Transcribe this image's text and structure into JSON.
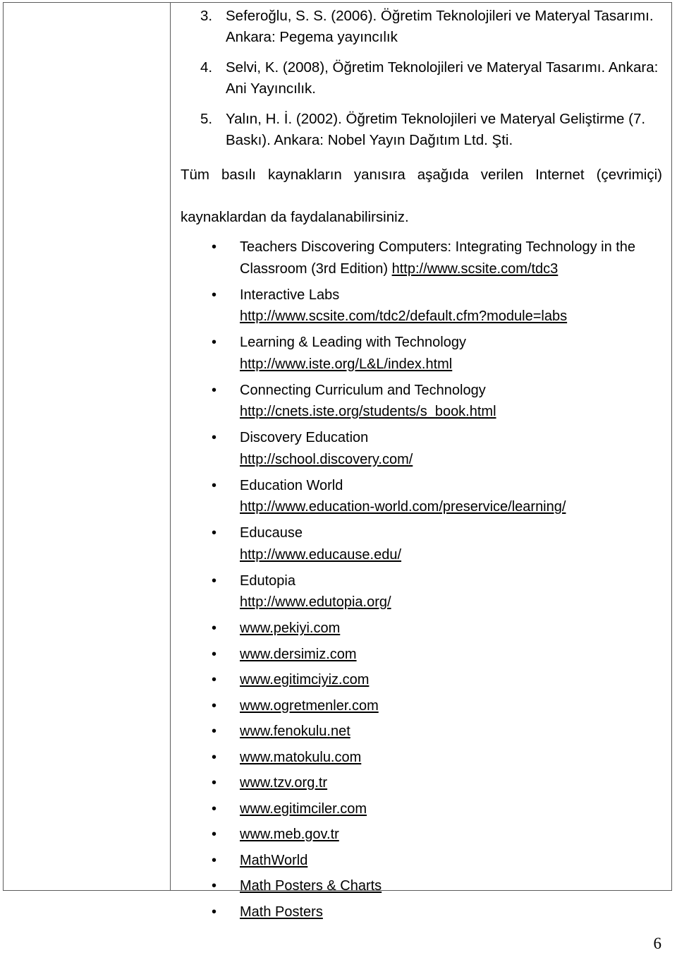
{
  "document": {
    "page_number": "6"
  },
  "references": {
    "items": [
      {
        "number": "3.",
        "text": "Seferoğlu, S. S. (2006). Öğretim Teknolojileri ve Materyal Tasarımı. Ankara: Pegema yayıncılık"
      },
      {
        "number": "4.",
        "text": "Selvi, K. (2008), Öğretim Teknolojileri ve Materyal Tasarımı. Ankara: Ani Yayıncılık."
      },
      {
        "number": "5.",
        "text": "Yalın, H. İ. (2002). Öğretim Teknolojileri ve Materyal Geliştirme (7. Baskı). Ankara: Nobel Yayın Dağıtım Ltd. Şti."
      }
    ]
  },
  "intro": {
    "line1": "Tüm basılı kaynakların yanısıra aşağıda verilen Internet (çevrimiçi)",
    "line2": "kaynaklardan da faydalanabilirsiniz."
  },
  "resources": {
    "bullet_glyph": "•",
    "items": [
      {
        "title": "Teachers Discovering Computers: Integrating Technology in the Classroom (3rd Edition)",
        "url": "http://www.scsite.com/tdc3",
        "layout": "inline"
      },
      {
        "title": "Interactive Labs",
        "url": "http://www.scsite.com/tdc2/default.cfm?module=labs",
        "layout": "two-line"
      },
      {
        "title": "Learning & Leading with Technology",
        "url": "http://www.iste.org/L&L/index.html",
        "layout": "two-line"
      },
      {
        "title": "Connecting Curriculum and Technology",
        "url": "http://cnets.iste.org/students/s_book.html",
        "layout": "two-line"
      },
      {
        "title": "Discovery Education",
        "url": "http://school.discovery.com/",
        "layout": "two-line"
      },
      {
        "title": "Education World",
        "url": "http://www.education-world.com/preservice/learning/",
        "layout": "two-line"
      },
      {
        "title": "Educause",
        "url": "http://www.educause.edu/",
        "layout": "two-line"
      },
      {
        "title": "Edutopia",
        "url": "http://www.edutopia.org/",
        "layout": "two-line"
      },
      {
        "title": "",
        "url": "www.pekiyi.com",
        "layout": "single"
      },
      {
        "title": "",
        "url": "www.dersimiz.com",
        "layout": "single"
      },
      {
        "title": "",
        "url": "www.egitimciyiz.com",
        "layout": "single"
      },
      {
        "title": "",
        "url": "www.ogretmenler.com",
        "layout": "single"
      },
      {
        "title": "",
        "url": "www.fenokulu.net",
        "layout": "single"
      },
      {
        "title": "",
        "url": "www.matokulu.com",
        "layout": "single"
      },
      {
        "title": "",
        "url": "www.tzv.org.tr",
        "layout": "single"
      },
      {
        "title": "",
        "url": "www.egitimciler.com",
        "layout": "single"
      },
      {
        "title": "",
        "url": "www.meb.gov.tr",
        "layout": "single"
      },
      {
        "title": "",
        "url": "MathWorld",
        "layout": "single"
      },
      {
        "title": "",
        "url": "Math Posters & Charts",
        "layout": "single"
      },
      {
        "title": "",
        "url": "Math Posters",
        "layout": "single"
      }
    ]
  }
}
